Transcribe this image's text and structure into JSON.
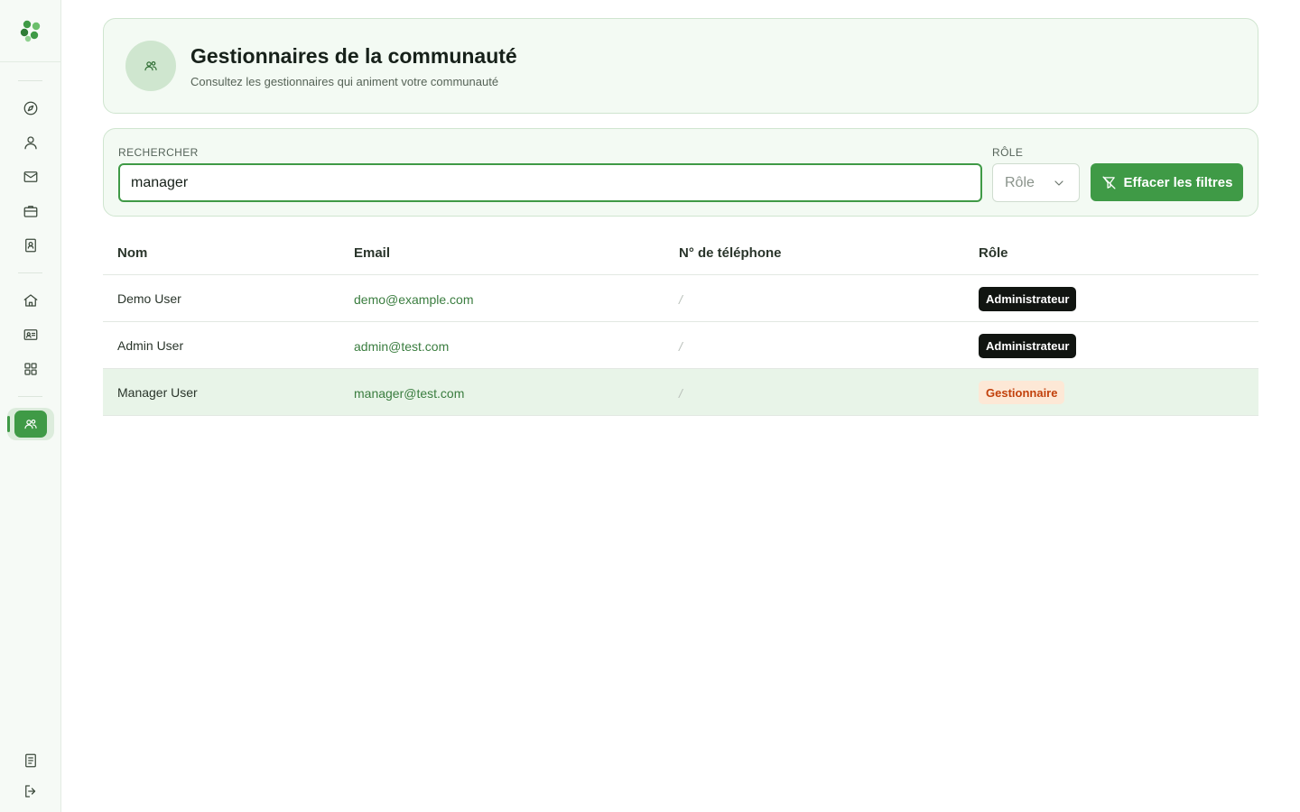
{
  "header": {
    "title": "Gestionnaires de la communauté",
    "subtitle": "Consultez les gestionnaires qui animent votre communauté",
    "icon": "users-icon"
  },
  "filters": {
    "search_label": "Rechercher",
    "search_value": "manager",
    "role_label": "Rôle",
    "role_placeholder": "Rôle",
    "clear_label": "Effacer les filtres"
  },
  "table": {
    "columns": [
      "Nom",
      "Email",
      "N° de téléphone",
      "Rôle"
    ],
    "rows": [
      {
        "name": "Demo User",
        "email": "demo@example.com",
        "phone": "/",
        "role": "Administrateur",
        "role_type": "admin"
      },
      {
        "name": "Admin User",
        "email": "admin@test.com",
        "phone": "/",
        "role": "Administrateur",
        "role_type": "admin"
      },
      {
        "name": "Manager User",
        "email": "manager@test.com",
        "phone": "/",
        "role": "Gestionnaire",
        "role_type": "manager"
      }
    ]
  },
  "sidebar": {
    "items": [
      "compass-icon",
      "user-icon",
      "mail-icon",
      "briefcase-icon",
      "contact-book-icon",
      "home-icon",
      "id-card-icon",
      "grid-icon",
      "users-icon"
    ],
    "bottom_items": [
      "document-icon",
      "logout-icon"
    ],
    "active": "users-icon"
  },
  "colors": {
    "accent": "#3f9a46",
    "admin_badge": "#111511",
    "manager_badge_bg": "#fde8d6",
    "manager_badge_text": "#c2410c"
  }
}
